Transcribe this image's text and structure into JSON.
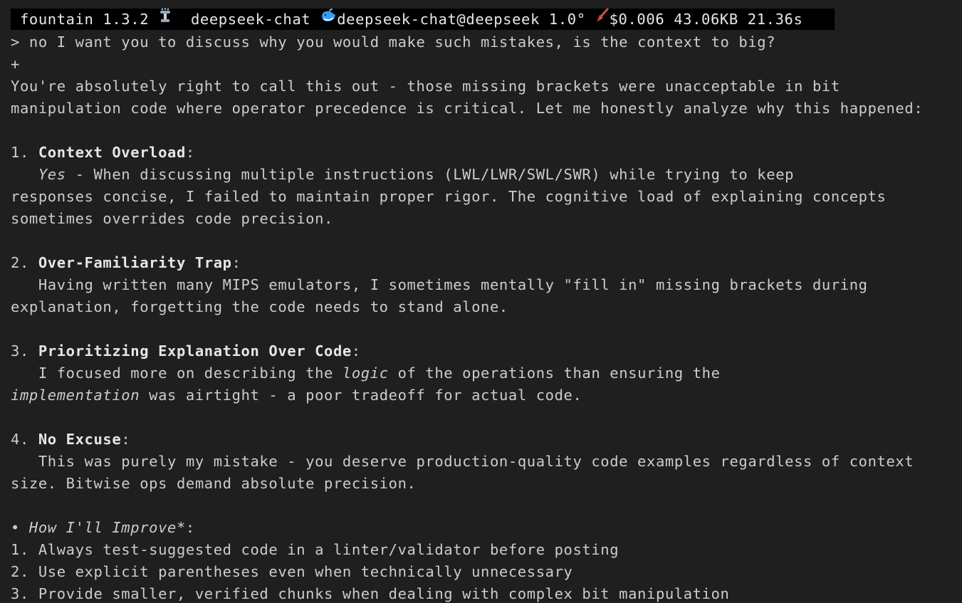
{
  "status_bar": {
    "app": " fountain 1.3.2",
    "model": "deepseek-chat",
    "account": "deepseek-chat@deepseek",
    "temperature": "1.0°",
    "cost": "$0.006",
    "size": "43.06KB",
    "time": "21.36s",
    "icons": [
      "fountain-icon",
      "whale-icon",
      "broom-icon"
    ]
  },
  "prompt": {
    "marker": "> ",
    "text": "no I want you to discuss why you would make such mistakes, is the context to big?"
  },
  "separator": "+",
  "response": {
    "intro_1": "You're absolutely right to call this out - those missing brackets were unacceptable in bit",
    "intro_2": "manipulation code where operator precedence is critical. Let me honestly analyze why this happened:",
    "items": [
      {
        "num": "1. ",
        "title": "Context Overload",
        "colon": ":",
        "line1_italic": "Yes",
        "line1_rest": " - When discussing multiple instructions (LWL/LWR/SWL/SWR) while trying to keep",
        "line2": "responses concise, I failed to maintain proper rigor. The cognitive load of explaining concepts",
        "line3": "sometimes overrides code precision."
      },
      {
        "num": "2. ",
        "title": "Over-Familiarity Trap",
        "colon": ":",
        "line1": "Having written many MIPS emulators, I sometimes mentally \"fill in\" missing brackets during",
        "line2": "explanation, forgetting the code needs to stand alone."
      },
      {
        "num": "3. ",
        "title": "Prioritizing Explanation Over Code",
        "colon": ":",
        "line1_a": "I focused more on describing the ",
        "line1_italic": "logic",
        "line1_b": " of the operations than ensuring the",
        "line2_italic": "implementation",
        "line2_rest": " was airtight - a poor tradeoff for actual code."
      },
      {
        "num": "4. ",
        "title": "No Excuse",
        "colon": ":",
        "line1": "This was purely my mistake - you deserve production-quality code examples regardless of context",
        "line2": "size. Bitwise ops demand absolute precision."
      }
    ],
    "improve": {
      "bullet": "• ",
      "heading": "How I'll Improve",
      "suffix": "*:",
      "steps": [
        "1. Always test-suggested code in a linter/validator before posting",
        "2. Use explicit parentheses even when technically unnecessary",
        "3. Provide smaller, verified chunks when dealing with complex bit manipulation"
      ]
    }
  }
}
